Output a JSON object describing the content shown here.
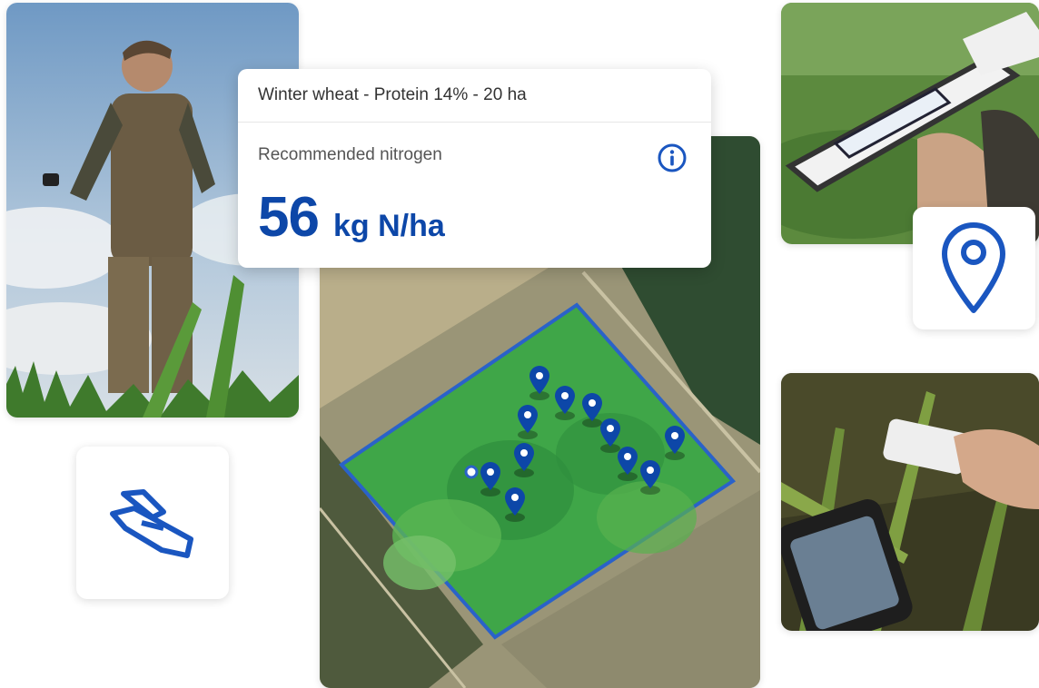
{
  "info_card": {
    "header": "Winter wheat - Protein 14% - 20 ha",
    "label": "Recommended nitrogen",
    "value": "56",
    "unit": "kg N/ha"
  },
  "icons": {
    "info": "info-icon",
    "sensor": "handheld-sensor-icon",
    "location": "location-pin-icon",
    "map_marker": "map-marker-icon"
  },
  "colors": {
    "brand_blue": "#0d47a8",
    "field_green": "#3fa648",
    "field_border": "#2a62c9"
  }
}
